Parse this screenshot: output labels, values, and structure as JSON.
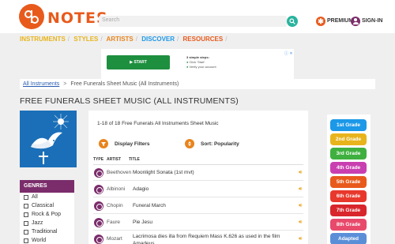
{
  "header": {
    "logo_text": "NOTES",
    "search_placeholder": "Search",
    "premium_label": "PREMIUM",
    "signin_label": "SIGN-IN"
  },
  "nav": [
    {
      "label": "INSTRUMENTS",
      "color": "#e8b41c"
    },
    {
      "label": "STYLES",
      "color": "#e8b41c"
    },
    {
      "label": "ARTISTS",
      "color": "#e8841c"
    },
    {
      "label": "DISCOVER",
      "color": "#1c98e8"
    },
    {
      "label": "RESOURCES",
      "color": "#e85a1c"
    }
  ],
  "ad": {
    "button": "START",
    "steps_title": "3 simple steps:",
    "step1": "Click 'Start'",
    "step2": "Verify your account",
    "close": "ⓘ ✕"
  },
  "breadcrumb": {
    "link": "All Instruments",
    "arrow": ">",
    "current": "Free Funerals Sheet Music (All Instruments)"
  },
  "page_title": "FREE FUNERALS SHEET MUSIC (ALL INSTRUMENTS)",
  "genres": {
    "header": "GENRES",
    "items": [
      "All",
      "Classical",
      "Rock & Pop",
      "Jazz",
      "Traditional",
      "World"
    ]
  },
  "results": {
    "count_text": "1-18 of 18 Free Funerals All Instruments Sheet Music",
    "display_filters": "Display Filters",
    "sort": "Sort: Popularity",
    "columns": {
      "type": "TYPE",
      "artist": "ARTIST",
      "title": "TITLE"
    },
    "rows": [
      {
        "artist": "Beethoven",
        "title": "Moonlight Sonata (1st mvt)"
      },
      {
        "artist": "Albinoni",
        "title": "Adagio"
      },
      {
        "artist": "Chopin",
        "title": "Funeral March"
      },
      {
        "artist": "Faure",
        "title": "Pie Jesu"
      },
      {
        "artist": "Mozart",
        "title": "Lacrimosa dies illa from Requiem Mass K.626 as used in the film Amadeus"
      }
    ]
  },
  "grades": [
    {
      "label": "1st Grade",
      "color": "#1c98e8"
    },
    {
      "label": "2nd Grade",
      "color": "#e8b41c"
    },
    {
      "label": "3rd Grade",
      "color": "#3fb03f"
    },
    {
      "label": "4th Grade",
      "color": "#c93fb0"
    },
    {
      "label": "5th Grade",
      "color": "#e85a1c"
    },
    {
      "label": "6th Grade",
      "color": "#e8382c"
    },
    {
      "label": "7th Grade",
      "color": "#d8262c"
    },
    {
      "label": "8th Grade",
      "color": "#e84a6c"
    },
    {
      "label": "Adapted",
      "color": "#5a8fd8"
    }
  ]
}
